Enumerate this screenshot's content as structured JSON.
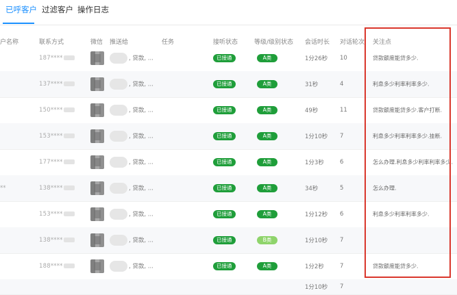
{
  "tabs": [
    {
      "label": "已呼客户"
    },
    {
      "label": "过滤客户"
    },
    {
      "label": "操作日志"
    }
  ],
  "table": {
    "columns": {
      "name": "户名称",
      "phone": "联系方式",
      "wechat": "微信",
      "pusher": "推送给",
      "task": "任务",
      "connect_status": "接听状态",
      "level": "等级/级别状态",
      "duration": "会话时长",
      "rounds": "对话轮次",
      "focus": "关注点"
    },
    "rows": [
      {
        "name": "",
        "phone": "187****",
        "pusher_text": ", 贷款, ...",
        "status": "已接通",
        "level": "A类",
        "duration": "1分26秒",
        "rounds": "10",
        "focus": "贷款额度能贷多少."
      },
      {
        "name": "",
        "phone": "137****",
        "pusher_text": ", 贷款, ...",
        "status": "已接通",
        "level": "A类",
        "duration": "31秒",
        "rounds": "4",
        "focus": "利息多少利率利率多少."
      },
      {
        "name": "",
        "phone": "150****",
        "pusher_text": ", 贷款, ...",
        "status": "已接通",
        "level": "A类",
        "duration": "49秒",
        "rounds": "11",
        "focus": "贷款额度能贷多少.客户打断."
      },
      {
        "name": "",
        "phone": "153****",
        "pusher_text": ", 贷款, ...",
        "status": "已接通",
        "level": "A类",
        "duration": "1分10秒",
        "rounds": "7",
        "focus": "利息多少利率利率多少.挂断."
      },
      {
        "name": "",
        "phone": "177****",
        "pusher_text": ", 贷款, ...",
        "status": "已接通",
        "level": "A类",
        "duration": "1分3秒",
        "rounds": "6",
        "focus": "怎么办理.利息多少利率利率多少."
      },
      {
        "name": "**",
        "phone": "138****",
        "pusher_text": ", 贷款, ...",
        "status": "已接通",
        "level": "A类",
        "duration": "34秒",
        "rounds": "5",
        "focus": "怎么办理."
      },
      {
        "name": "",
        "phone": "153****",
        "pusher_text": ", 贷款, ...",
        "status": "已接通",
        "level": "A类",
        "duration": "1分12秒",
        "rounds": "6",
        "focus": "利息多少利率利率多少."
      },
      {
        "name": "",
        "phone": "138****",
        "pusher_text": ", 贷款, ...",
        "status": "已接通",
        "level": "B类",
        "duration": "1分10秒",
        "rounds": "7",
        "focus": ""
      },
      {
        "name": "",
        "phone": "188****",
        "pusher_text": ", 贷款, ...",
        "status": "已接通",
        "level": "A类",
        "duration": "1分2秒",
        "rounds": "7",
        "focus": "贷款额度能贷多少."
      },
      {
        "name": "",
        "phone": "",
        "pusher_text": "",
        "status": "",
        "level": "",
        "duration": "1分10秒",
        "rounds": "7",
        "focus": ""
      }
    ]
  },
  "colors": {
    "accent": "#1a8fff",
    "badge_green": "#1f9e3a",
    "badge_light_green": "#8fd46b",
    "highlight_red": "#d9352a"
  }
}
